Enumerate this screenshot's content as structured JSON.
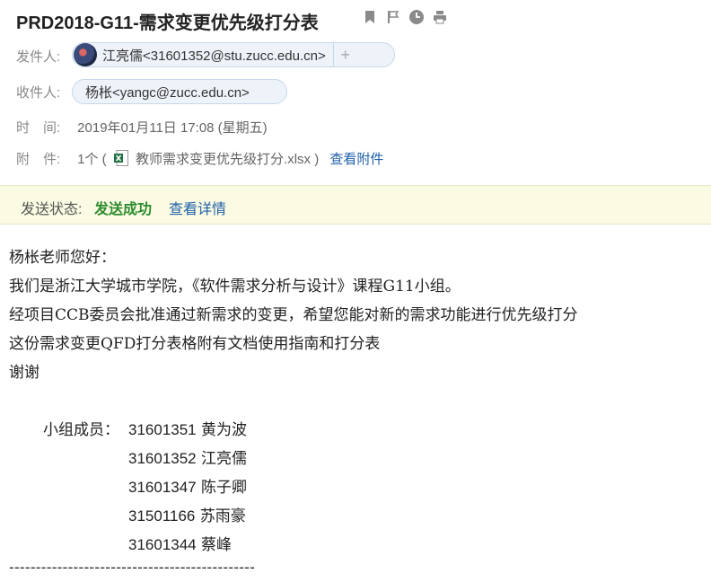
{
  "subject": "PRD2018-G11-需求变更优先级打分表",
  "header": {
    "from_label": "发件人:",
    "from_name": "江亮儒<31601352@stu.zucc.edu.cn>",
    "to_label": "收件人:",
    "to_name": "杨枨<yangc@zucc.edu.cn>",
    "time_label": "时　间:",
    "time_value": "2019年01月11日 17:08 (星期五)",
    "attach_label": "附　件:",
    "attach_count": "1个 (",
    "attach_file": "教师需求变更优先级打分.xlsx )",
    "attach_view": "查看附件"
  },
  "status": {
    "label": "发送状态:",
    "value": "发送成功",
    "detail": "查看详情"
  },
  "body": {
    "greeting": "杨枨老师您好：",
    "line1": "我们是浙江大学城市学院，《软件需求分析与设计》课程G11小组。",
    "line2": "经项目CCB委员会批准通过新需求的变更，希望您能对新的需求功能进行优先级打分",
    "line3": "这份需求变更QFD打分表格附有文档使用指南和打分表",
    "line4": "谢谢",
    "members_label": "小组成员：",
    "members": [
      {
        "id": "31601351",
        "name": "黄为波"
      },
      {
        "id": "31601352",
        "name": "江亮儒"
      },
      {
        "id": "31601347",
        "name": "陈子卿"
      },
      {
        "id": "31501166",
        "name": "苏雨豪"
      },
      {
        "id": "31601344",
        "name": "蔡峰"
      }
    ],
    "divider": "----------------------------------------------"
  },
  "icons": [
    "bookmark-icon",
    "flag-icon",
    "clock-icon",
    "print-icon",
    "excel-icon",
    "add-contact-icon"
  ],
  "colors": {
    "status_ok": "#2e8b2e",
    "link": "#1f5faa",
    "status_bar_bg": "#fbfbe3"
  }
}
